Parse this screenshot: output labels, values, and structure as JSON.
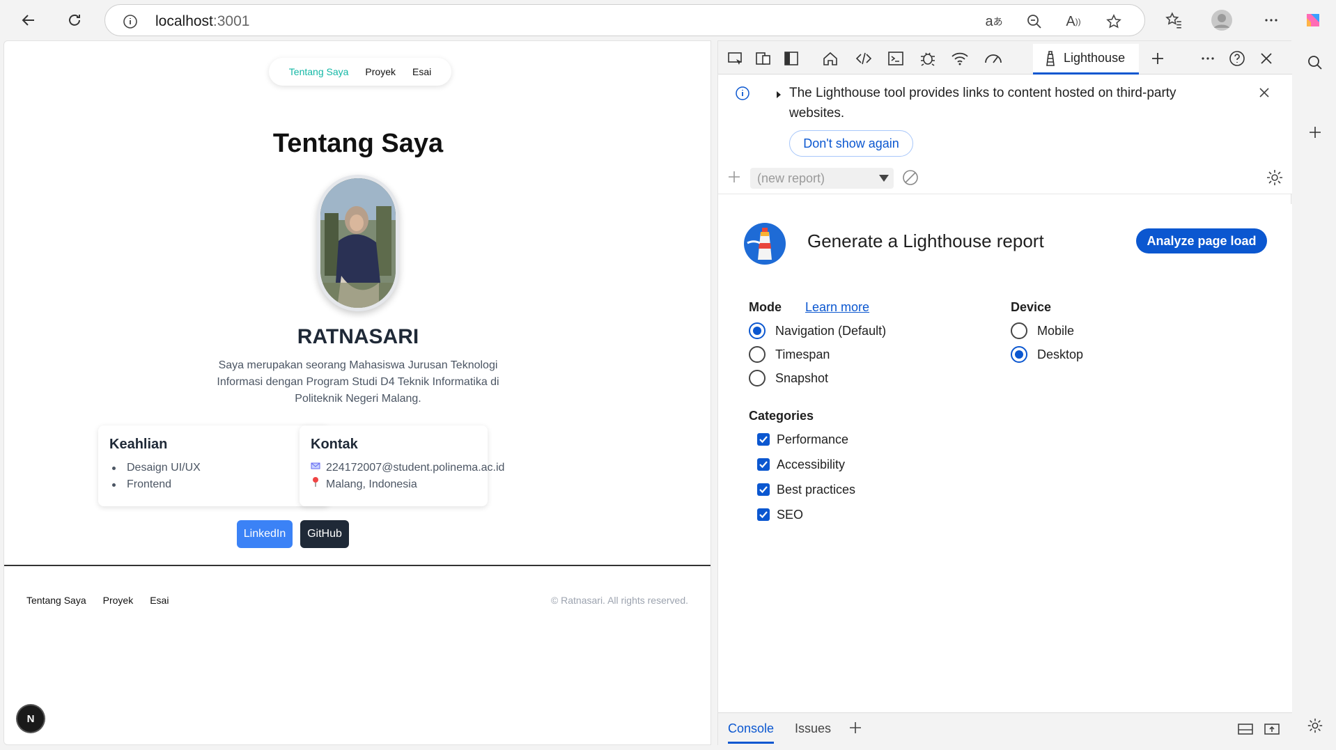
{
  "browser": {
    "url_host": "localhost",
    "url_port": ":3001"
  },
  "page": {
    "top_nav": [
      "Tentang Saya",
      "Proyek",
      "Esai"
    ],
    "title": "Tentang Saya",
    "name": "RATNASARI",
    "bio": "Saya merupakan seorang Mahasiswa Jurusan Teknologi Informasi dengan Program Studi D4 Teknik Informatika di Politeknik Negeri Malang.",
    "skills": {
      "heading": "Keahlian",
      "items": [
        "Desaign UI/UX",
        "Frontend"
      ]
    },
    "contact": {
      "heading": "Kontak",
      "email": "224172007@student.polinema.ac.id",
      "location": "Malang, Indonesia"
    },
    "buttons": {
      "linkedin": "LinkedIn",
      "github": "GitHub"
    },
    "footer": {
      "nav": [
        "Tentang Saya",
        "Proyek",
        "Esai"
      ],
      "copyright": "© Ratnasari. All rights reserved."
    },
    "next_badge": "N"
  },
  "devtools": {
    "active_tab": "Lighthouse",
    "banner_text": "The Lighthouse tool provides links to content hosted on third-party websites.",
    "dont_show": "Don't show again",
    "report_select": "(new report)",
    "lighthouse": {
      "title": "Generate a Lighthouse report",
      "analyze": "Analyze page load",
      "mode_label": "Mode",
      "learn_more": "Learn more",
      "modes": [
        "Navigation (Default)",
        "Timespan",
        "Snapshot"
      ],
      "selected_mode": "Navigation (Default)",
      "device_label": "Device",
      "devices": [
        "Mobile",
        "Desktop"
      ],
      "selected_device": "Desktop",
      "categories_label": "Categories",
      "categories": [
        "Performance",
        "Accessibility",
        "Best practices",
        "SEO"
      ]
    },
    "bottom_tabs": [
      "Console",
      "Issues"
    ]
  },
  "colors": {
    "accent": "#0b57d0",
    "teal": "#14b8a6",
    "linkedin": "#3b82f6",
    "github": "#1f2937"
  }
}
